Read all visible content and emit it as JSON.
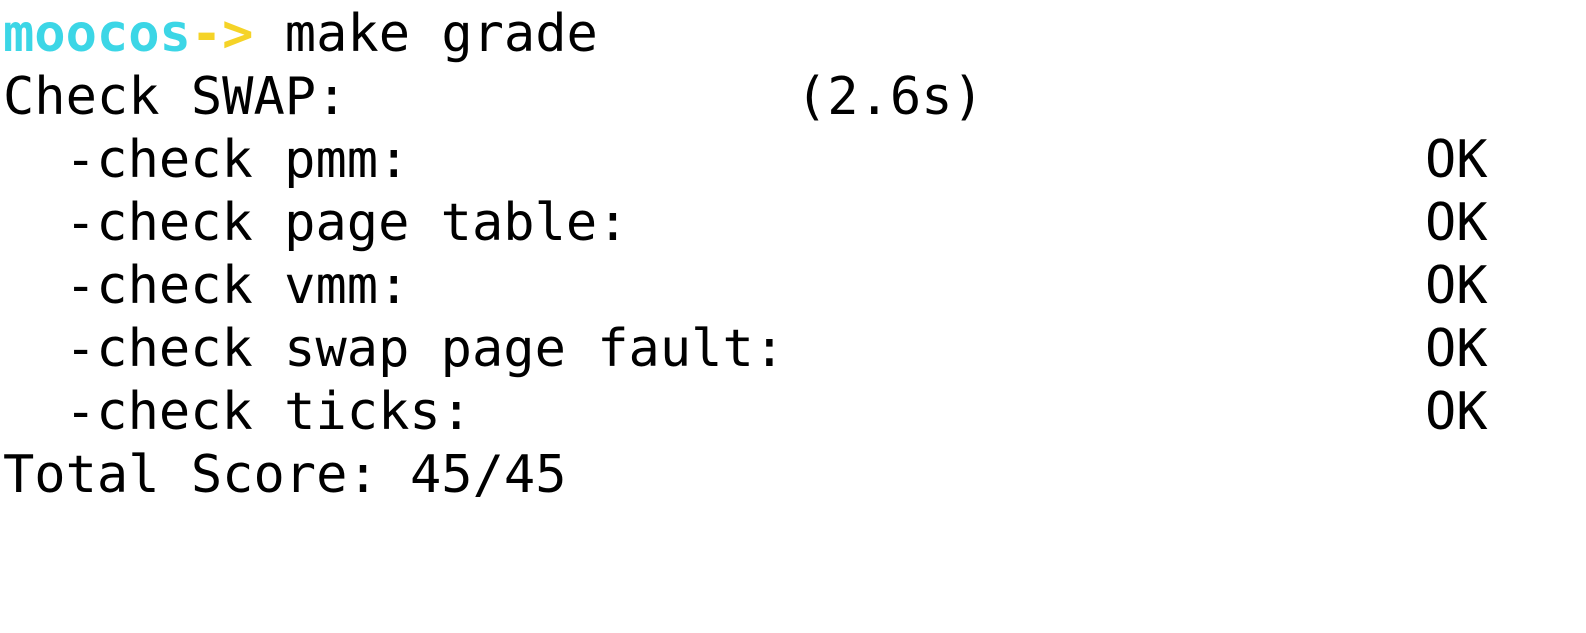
{
  "prompt": {
    "user": "moocos",
    "arrow": "->",
    "command": "make grade"
  },
  "suite": {
    "label": "Check SWAP:",
    "time": "(2.6s)"
  },
  "checks": [
    {
      "label": "-check pmm:",
      "status": "OK"
    },
    {
      "label": "-check page table:",
      "status": "OK"
    },
    {
      "label": "-check vmm:",
      "status": "OK"
    },
    {
      "label": "-check swap page fault:",
      "status": "OK"
    },
    {
      "label": "-check ticks:",
      "status": "OK"
    }
  ],
  "total": {
    "text": "Total Score: 45/45"
  },
  "colors": {
    "prompt_user": "#3cd6e6",
    "prompt_arrow": "#f5d327",
    "text": "#000000",
    "background": "#ffffff"
  }
}
